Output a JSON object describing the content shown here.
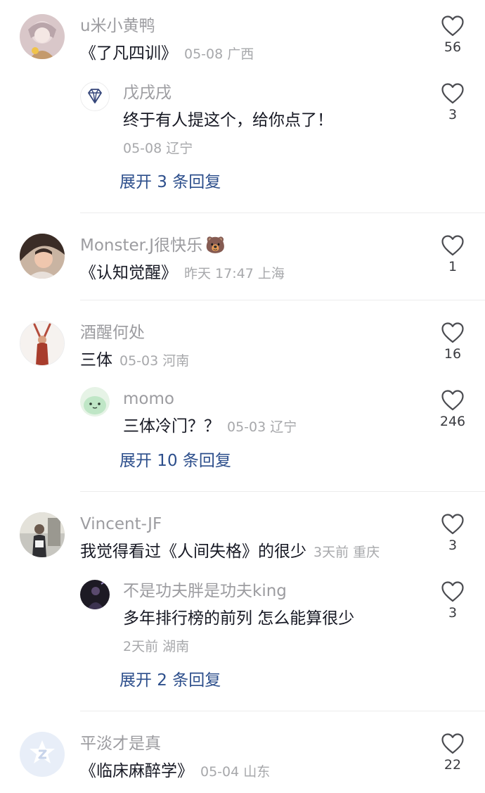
{
  "comments": [
    {
      "username": "u米小黄鸭",
      "text": "《了凡四训》",
      "date": "05-08",
      "location": "广西",
      "likes": "56",
      "replies": [
        {
          "username": "戊戌戌",
          "text": "终于有人提这个，给你点了！",
          "date": "05-08",
          "location": "辽宁",
          "likes": "3"
        }
      ],
      "expand_label": "展开 3 条回复"
    },
    {
      "username": "Monster.J很快乐",
      "username_emoji": "🐻",
      "text": "《认知觉醒》",
      "date": "昨天 17:47",
      "location": "上海",
      "likes": "1"
    },
    {
      "username": "酒醒何处",
      "text": "三体",
      "date": "05-03",
      "location": "河南",
      "likes": "16",
      "replies": [
        {
          "username": "momo",
          "text": "三体冷门？？",
          "date": "05-03",
          "location": "辽宁",
          "likes": "246"
        }
      ],
      "expand_label": "展开 10 条回复"
    },
    {
      "username": "Vincent-JF",
      "text": "我觉得看过《人间失格》的很少",
      "date": "3天前",
      "location": "重庆",
      "likes": "3",
      "replies": [
        {
          "username": "不是功夫胖是功夫king",
          "text": "多年排行榜的前列 怎么能算很少",
          "date": "2天前",
          "location": "湖南",
          "likes": "3"
        }
      ],
      "expand_label": "展开 2 条回复"
    },
    {
      "username": "平淡才是真",
      "text": "《临床麻醉学》",
      "date": "05-04",
      "location": "山东",
      "likes": "22"
    }
  ],
  "icons": {
    "like": "heart-outline-icon",
    "verified_badge": "diamond-icon",
    "default_avatar": "tiktok-logo-icon"
  },
  "colors": {
    "username": "#9c9ca0",
    "text": "#161823",
    "meta": "#a7a8ab",
    "link": "#2d4f8c",
    "divider": "#ececed"
  }
}
